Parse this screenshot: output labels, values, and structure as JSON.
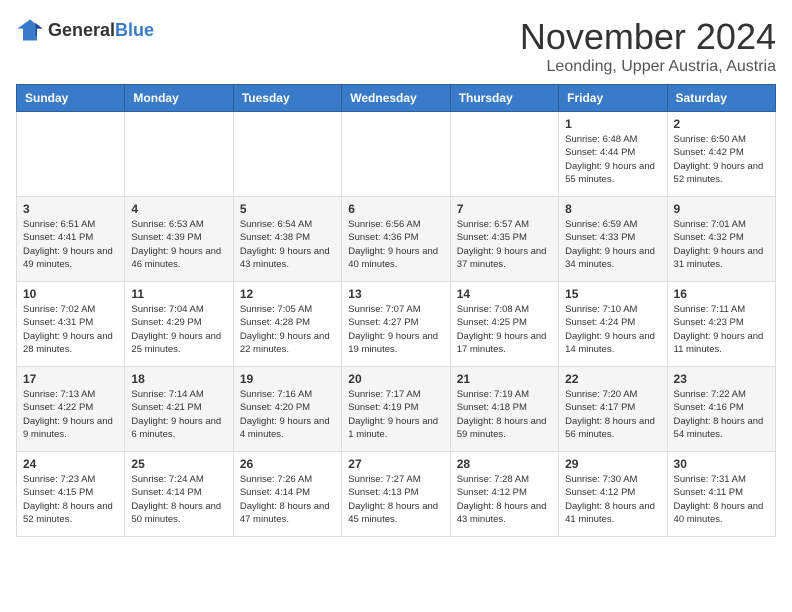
{
  "logo": {
    "text_general": "General",
    "text_blue": "Blue"
  },
  "header": {
    "month_title": "November 2024",
    "location": "Leonding, Upper Austria, Austria"
  },
  "weekdays": [
    "Sunday",
    "Monday",
    "Tuesday",
    "Wednesday",
    "Thursday",
    "Friday",
    "Saturday"
  ],
  "weeks": [
    [
      {
        "day": "",
        "info": ""
      },
      {
        "day": "",
        "info": ""
      },
      {
        "day": "",
        "info": ""
      },
      {
        "day": "",
        "info": ""
      },
      {
        "day": "",
        "info": ""
      },
      {
        "day": "1",
        "info": "Sunrise: 6:48 AM\nSunset: 4:44 PM\nDaylight: 9 hours and 55 minutes."
      },
      {
        "day": "2",
        "info": "Sunrise: 6:50 AM\nSunset: 4:42 PM\nDaylight: 9 hours and 52 minutes."
      }
    ],
    [
      {
        "day": "3",
        "info": "Sunrise: 6:51 AM\nSunset: 4:41 PM\nDaylight: 9 hours and 49 minutes."
      },
      {
        "day": "4",
        "info": "Sunrise: 6:53 AM\nSunset: 4:39 PM\nDaylight: 9 hours and 46 minutes."
      },
      {
        "day": "5",
        "info": "Sunrise: 6:54 AM\nSunset: 4:38 PM\nDaylight: 9 hours and 43 minutes."
      },
      {
        "day": "6",
        "info": "Sunrise: 6:56 AM\nSunset: 4:36 PM\nDaylight: 9 hours and 40 minutes."
      },
      {
        "day": "7",
        "info": "Sunrise: 6:57 AM\nSunset: 4:35 PM\nDaylight: 9 hours and 37 minutes."
      },
      {
        "day": "8",
        "info": "Sunrise: 6:59 AM\nSunset: 4:33 PM\nDaylight: 9 hours and 34 minutes."
      },
      {
        "day": "9",
        "info": "Sunrise: 7:01 AM\nSunset: 4:32 PM\nDaylight: 9 hours and 31 minutes."
      }
    ],
    [
      {
        "day": "10",
        "info": "Sunrise: 7:02 AM\nSunset: 4:31 PM\nDaylight: 9 hours and 28 minutes."
      },
      {
        "day": "11",
        "info": "Sunrise: 7:04 AM\nSunset: 4:29 PM\nDaylight: 9 hours and 25 minutes."
      },
      {
        "day": "12",
        "info": "Sunrise: 7:05 AM\nSunset: 4:28 PM\nDaylight: 9 hours and 22 minutes."
      },
      {
        "day": "13",
        "info": "Sunrise: 7:07 AM\nSunset: 4:27 PM\nDaylight: 9 hours and 19 minutes."
      },
      {
        "day": "14",
        "info": "Sunrise: 7:08 AM\nSunset: 4:25 PM\nDaylight: 9 hours and 17 minutes."
      },
      {
        "day": "15",
        "info": "Sunrise: 7:10 AM\nSunset: 4:24 PM\nDaylight: 9 hours and 14 minutes."
      },
      {
        "day": "16",
        "info": "Sunrise: 7:11 AM\nSunset: 4:23 PM\nDaylight: 9 hours and 11 minutes."
      }
    ],
    [
      {
        "day": "17",
        "info": "Sunrise: 7:13 AM\nSunset: 4:22 PM\nDaylight: 9 hours and 9 minutes."
      },
      {
        "day": "18",
        "info": "Sunrise: 7:14 AM\nSunset: 4:21 PM\nDaylight: 9 hours and 6 minutes."
      },
      {
        "day": "19",
        "info": "Sunrise: 7:16 AM\nSunset: 4:20 PM\nDaylight: 9 hours and 4 minutes."
      },
      {
        "day": "20",
        "info": "Sunrise: 7:17 AM\nSunset: 4:19 PM\nDaylight: 9 hours and 1 minute."
      },
      {
        "day": "21",
        "info": "Sunrise: 7:19 AM\nSunset: 4:18 PM\nDaylight: 8 hours and 59 minutes."
      },
      {
        "day": "22",
        "info": "Sunrise: 7:20 AM\nSunset: 4:17 PM\nDaylight: 8 hours and 56 minutes."
      },
      {
        "day": "23",
        "info": "Sunrise: 7:22 AM\nSunset: 4:16 PM\nDaylight: 8 hours and 54 minutes."
      }
    ],
    [
      {
        "day": "24",
        "info": "Sunrise: 7:23 AM\nSunset: 4:15 PM\nDaylight: 8 hours and 52 minutes."
      },
      {
        "day": "25",
        "info": "Sunrise: 7:24 AM\nSunset: 4:14 PM\nDaylight: 8 hours and 50 minutes."
      },
      {
        "day": "26",
        "info": "Sunrise: 7:26 AM\nSunset: 4:14 PM\nDaylight: 8 hours and 47 minutes."
      },
      {
        "day": "27",
        "info": "Sunrise: 7:27 AM\nSunset: 4:13 PM\nDaylight: 8 hours and 45 minutes."
      },
      {
        "day": "28",
        "info": "Sunrise: 7:28 AM\nSunset: 4:12 PM\nDaylight: 8 hours and 43 minutes."
      },
      {
        "day": "29",
        "info": "Sunrise: 7:30 AM\nSunset: 4:12 PM\nDaylight: 8 hours and 41 minutes."
      },
      {
        "day": "30",
        "info": "Sunrise: 7:31 AM\nSunset: 4:11 PM\nDaylight: 8 hours and 40 minutes."
      }
    ]
  ]
}
